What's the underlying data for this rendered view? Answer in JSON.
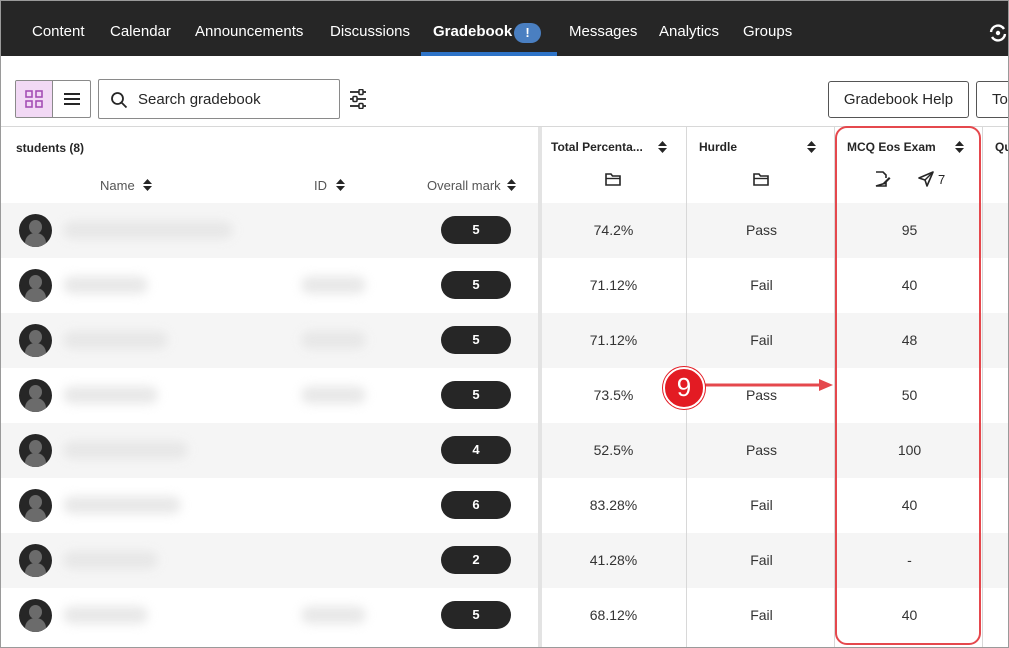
{
  "nav": {
    "items": [
      "Content",
      "Calendar",
      "Announcements",
      "Discussions",
      "Gradebook",
      "Messages",
      "Analytics",
      "Groups"
    ],
    "active": "Gradebook",
    "gradebook_badge": "!"
  },
  "toolbar": {
    "search_placeholder": "Search gradebook",
    "help_button": "Gradebook Help",
    "cut_button": "To"
  },
  "grid": {
    "students_header": "students (8)",
    "col_name": "Name",
    "col_id": "ID",
    "col_overall": "Overall mark",
    "items": [
      {
        "title": "Total Percenta...",
        "icon": "folder-icon"
      },
      {
        "title": "Hurdle",
        "icon": "folder-icon"
      },
      {
        "title": "MCQ Eos Exam",
        "icon": "edit-document-icon",
        "submissions": "7"
      },
      {
        "title": "Qu"
      }
    ],
    "rows": [
      {
        "overall": "5",
        "total": "74.2%",
        "hurdle": "Pass",
        "mcq": "95"
      },
      {
        "overall": "5",
        "total": "71.12%",
        "hurdle": "Fail",
        "mcq": "40"
      },
      {
        "overall": "5",
        "total": "71.12%",
        "hurdle": "Fail",
        "mcq": "48"
      },
      {
        "overall": "5",
        "total": "73.5%",
        "hurdle": "Pass",
        "mcq": "50"
      },
      {
        "overall": "4",
        "total": "52.5%",
        "hurdle": "Pass",
        "mcq": "100"
      },
      {
        "overall": "6",
        "total": "83.28%",
        "hurdle": "Fail",
        "mcq": "40"
      },
      {
        "overall": "2",
        "total": "41.28%",
        "hurdle": "Fail",
        "mcq": "-"
      },
      {
        "overall": "5",
        "total": "68.12%",
        "hurdle": "Fail",
        "mcq": "40"
      }
    ]
  },
  "annotation": {
    "callout_number": "9",
    "highlight_color": "#e5484d"
  },
  "colors": {
    "nav_bg": "#262626",
    "accent": "#2e73c7",
    "toggle_selected": "#f2d9f5",
    "pill_bg": "#262626"
  }
}
